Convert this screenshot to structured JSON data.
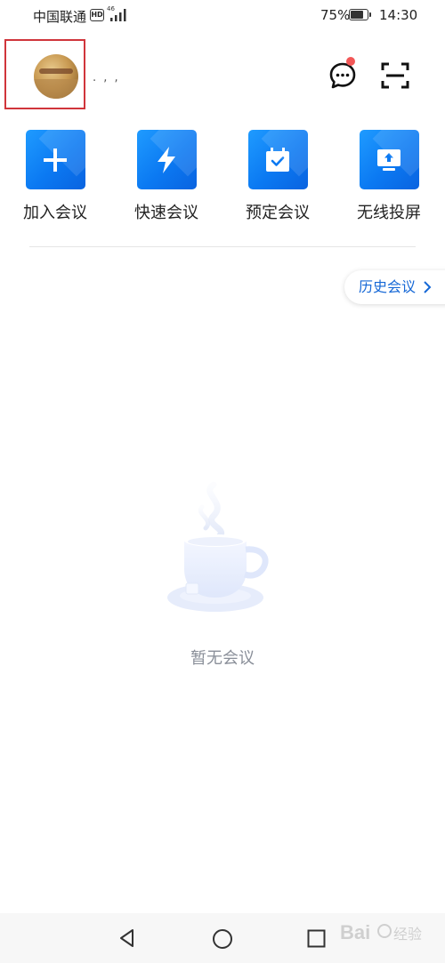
{
  "status_bar": {
    "carrier": "中国联通",
    "hd": "HD",
    "network_type": "46",
    "battery_percent": "75%",
    "battery_level": 0.75,
    "time": "14:30"
  },
  "header": {
    "username": ". , ,",
    "message_unread": true
  },
  "actions": [
    {
      "label": "加入会议",
      "icon": "plus-icon"
    },
    {
      "label": "快速会议",
      "icon": "lightning-icon"
    },
    {
      "label": "预定会议",
      "icon": "calendar-check-icon"
    },
    {
      "label": "无线投屏",
      "icon": "screen-cast-icon"
    }
  ],
  "history_button": {
    "label": "历史会议"
  },
  "empty_state": {
    "text": "暂无会议",
    "icon": "coffee-cup-icon"
  },
  "watermark": {
    "text": "Bai 经验"
  },
  "colors": {
    "accent": "#0b79f2",
    "link": "#1668d6",
    "badge": "#f25757",
    "highlight_frame": "#d0353b"
  }
}
